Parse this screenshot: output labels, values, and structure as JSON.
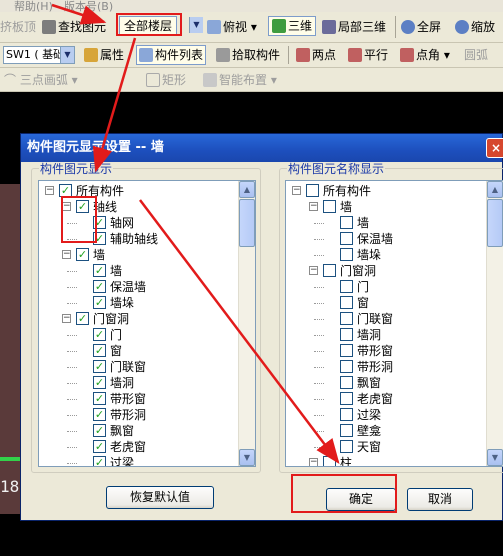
{
  "menu": {
    "help": "帮助(H)",
    "version": "版本号(B)"
  },
  "toolbar1": {
    "floor_slab": "挤板顶",
    "find_element": "查找图元",
    "all_floors": "全部楼层",
    "top_view": "俯视",
    "three_d": "三维",
    "local_three_d": "局部三维",
    "full_screen": "全屏",
    "zoom": "缩放"
  },
  "toolbar2": {
    "combo_value": "SW1 ( 基础",
    "properties": "属性",
    "component_list": "构件列表",
    "pick_component": "拾取构件",
    "two_points": "两点",
    "parallel": "平行",
    "point_angle": "点角",
    "circle_arc": "圆弧"
  },
  "toolbar3": {
    "three_point_arc": "三点画弧",
    "rectangle": "矩形",
    "smart_layout": "智能布置"
  },
  "canvas": {
    "axis_number": "18"
  },
  "dialog": {
    "title": "构件图元显示设置 -- 墙",
    "close_glyph": "×",
    "left_group_label": "构件图元显示",
    "right_group_label": "构件图元名称显示",
    "left_tree": [
      {
        "label": "所有构件",
        "checked": true,
        "level": 0,
        "expander": "−"
      },
      {
        "label": "轴线",
        "checked": true,
        "level": 1,
        "expander": "−"
      },
      {
        "label": "轴网",
        "checked": true,
        "level": 2
      },
      {
        "label": "辅助轴线",
        "checked": true,
        "level": 2
      },
      {
        "label": "墙",
        "checked": true,
        "level": 1,
        "expander": "−"
      },
      {
        "label": "墙",
        "checked": true,
        "level": 2
      },
      {
        "label": "保温墙",
        "checked": true,
        "level": 2
      },
      {
        "label": "墙垛",
        "checked": true,
        "level": 2
      },
      {
        "label": "门窗洞",
        "checked": true,
        "level": 1,
        "expander": "−"
      },
      {
        "label": "门",
        "checked": true,
        "level": 2
      },
      {
        "label": "窗",
        "checked": true,
        "level": 2
      },
      {
        "label": "门联窗",
        "checked": true,
        "level": 2
      },
      {
        "label": "墙洞",
        "checked": true,
        "level": 2
      },
      {
        "label": "带形窗",
        "checked": true,
        "level": 2
      },
      {
        "label": "带形洞",
        "checked": true,
        "level": 2
      },
      {
        "label": "飘窗",
        "checked": true,
        "level": 2
      },
      {
        "label": "老虎窗",
        "checked": true,
        "level": 2
      },
      {
        "label": "过梁",
        "checked": true,
        "level": 2
      }
    ],
    "right_tree": [
      {
        "label": "所有构件",
        "checked": false,
        "level": 0,
        "expander": "−"
      },
      {
        "label": "墙",
        "checked": false,
        "level": 1,
        "expander": "−"
      },
      {
        "label": "墙",
        "checked": false,
        "level": 2
      },
      {
        "label": "保温墙",
        "checked": false,
        "level": 2
      },
      {
        "label": "墙垛",
        "checked": false,
        "level": 2
      },
      {
        "label": "门窗洞",
        "checked": false,
        "level": 1,
        "expander": "−"
      },
      {
        "label": "门",
        "checked": false,
        "level": 2
      },
      {
        "label": "窗",
        "checked": false,
        "level": 2
      },
      {
        "label": "门联窗",
        "checked": false,
        "level": 2
      },
      {
        "label": "墙洞",
        "checked": false,
        "level": 2
      },
      {
        "label": "带形窗",
        "checked": false,
        "level": 2
      },
      {
        "label": "带形洞",
        "checked": false,
        "level": 2
      },
      {
        "label": "飘窗",
        "checked": false,
        "level": 2
      },
      {
        "label": "老虎窗",
        "checked": false,
        "level": 2
      },
      {
        "label": "过梁",
        "checked": false,
        "level": 2
      },
      {
        "label": "壁龛",
        "checked": false,
        "level": 2
      },
      {
        "label": "天窗",
        "checked": false,
        "level": 2
      },
      {
        "label": "柱",
        "checked": false,
        "level": 1,
        "expander": "−"
      }
    ],
    "restore_default": "恢复默认值",
    "ok": "确定",
    "cancel": "取消"
  },
  "colors": {
    "annotation_red": "#e21b1b",
    "title_blue": "#1d4fbd",
    "check_green": "#21a121"
  }
}
